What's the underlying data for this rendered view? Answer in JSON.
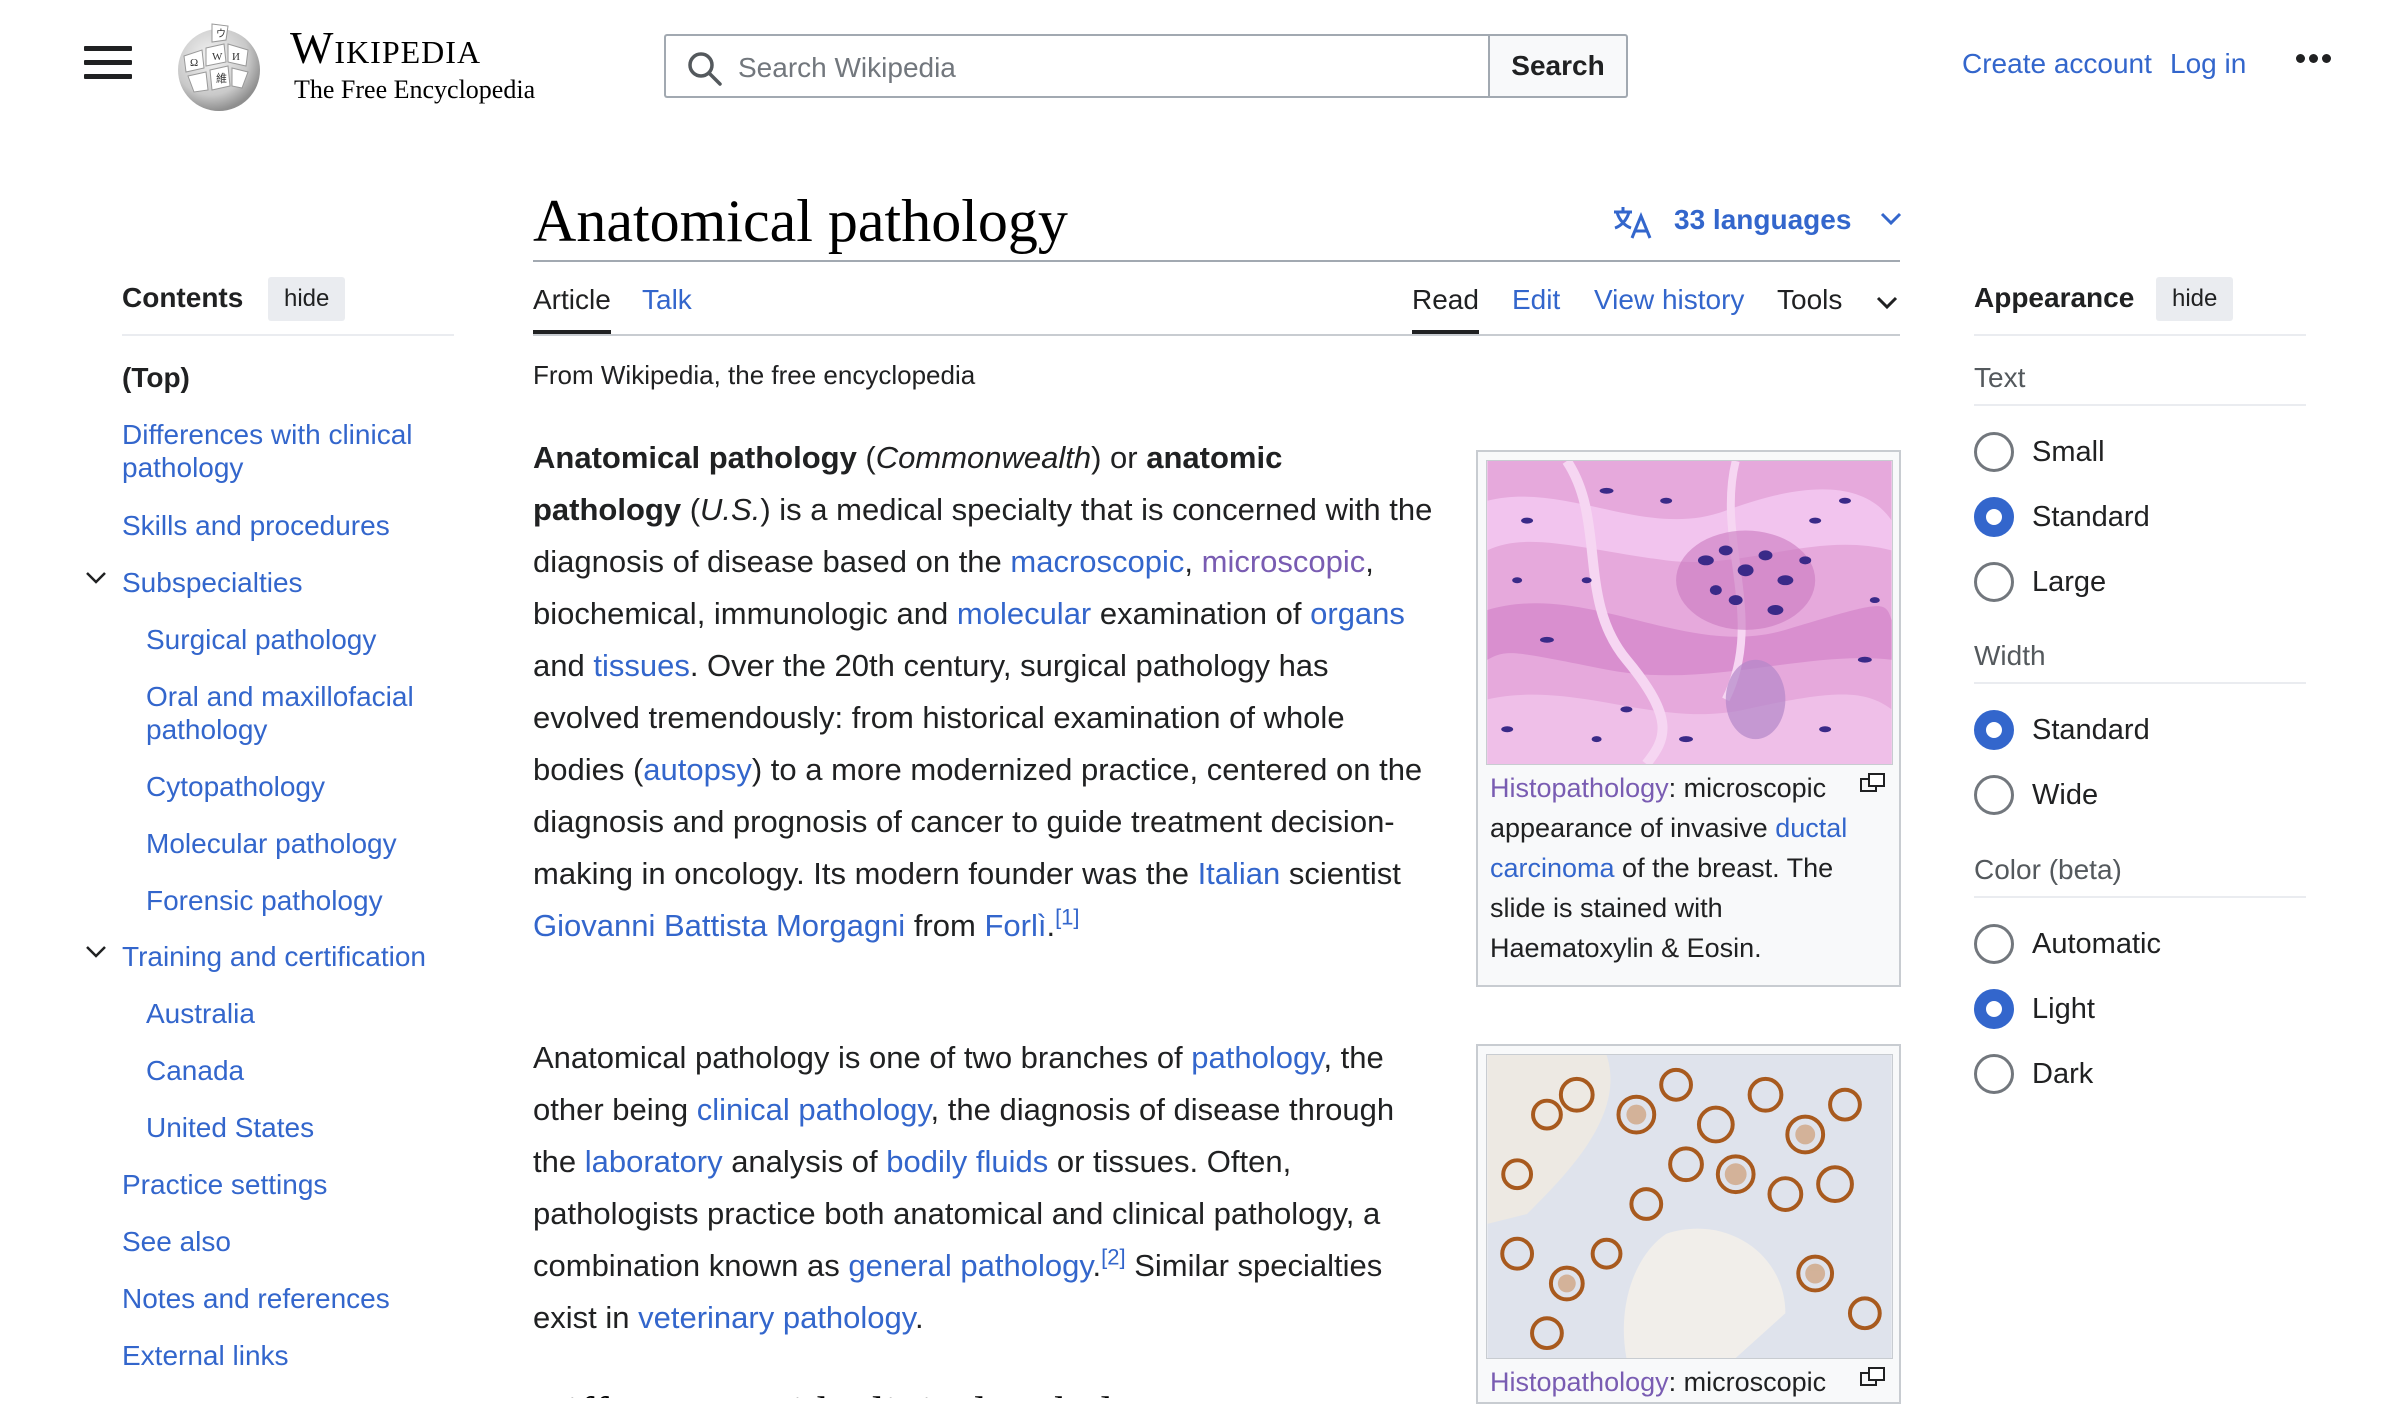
{
  "header": {
    "wordmark_title": "Wikipedia",
    "wordmark_tagline": "The Free Encyclopedia",
    "search_placeholder": "Search Wikipedia",
    "search_button": "Search",
    "create_account": "Create account",
    "log_in": "Log in"
  },
  "page": {
    "title": "Anatomical pathology",
    "languages": "33 languages",
    "tabs": {
      "article": "Article",
      "talk": "Talk",
      "read": "Read",
      "edit": "Edit",
      "view_history": "View history",
      "tools": "Tools"
    },
    "tagline": "From Wikipedia, the free encyclopedia"
  },
  "toc": {
    "heading": "Contents",
    "hide": "hide",
    "items": [
      "(Top)",
      "Differences with clinical pathology",
      "Skills and procedures",
      "Subspecialties",
      "Surgical pathology",
      "Oral and maxillofacial pathology",
      "Cytopathology",
      "Molecular pathology",
      "Forensic pathology",
      "Training and certification",
      "Australia",
      "Canada",
      "United States",
      "Practice settings",
      "See also",
      "Notes and references",
      "External links"
    ]
  },
  "article": {
    "p1": {
      "t1": "Anatomical pathology",
      "t2": " (",
      "t3": "Commonwealth",
      "t4": ") or ",
      "t5": "anatomic pathology",
      "t6": " (",
      "t7": "U.S.",
      "t8": ") is a medical specialty that is concerned with the diagnosis of disease based on the ",
      "l_macroscopic": "macroscopic",
      "t9": ", ",
      "l_microscopic": "microscopic",
      "t10": ", biochemical, immunologic and ",
      "l_molecular": "molecular",
      "t11": " examination of ",
      "l_organs": "organs",
      "t12": " and ",
      "l_tissues": "tissues",
      "t13": ". Over the 20th century, surgical pathology has evolved tremendously: from historical examination of whole bodies (",
      "l_autopsy": "autopsy",
      "t14": ") to a more modernized practice, centered on the diagnosis and prognosis of cancer to guide treatment decision-making in oncology. Its modern founder was the ",
      "l_italian": "Italian",
      "t15": " scientist ",
      "l_morgagni": "Giovanni Battista Morgagni",
      "t16": " from ",
      "l_forli": "Forlì",
      "t17": ".",
      "ref1": "[1]"
    },
    "p2": {
      "t1": "Anatomical pathology is one of two branches of ",
      "l_pathology": "pathology",
      "t2": ", the other being ",
      "l_clinical": "clinical pathology",
      "t3": ", the diagnosis of disease through the ",
      "l_laboratory": "laboratory",
      "t4": " analysis of ",
      "l_bodily": "bodily fluids",
      "t5": " or tissues. Often, pathologists practice both anatomical and clinical pathology, a combination known as ",
      "l_general": "general pathology",
      "t6": ".",
      "ref2": "[2]",
      "t7": " Similar specialties exist in ",
      "l_veterinary": "veterinary pathology",
      "t8": "."
    },
    "fig1": {
      "l_histo": "Histopathology",
      "t1": ": microscopic appearance of invasive ",
      "l_ductal": "ductal carcinoma",
      "t2": " of the breast. The slide is stained with Haematoxylin & Eosin."
    },
    "fig2": {
      "l_histo": "Histopathology",
      "t1": ": microscopic"
    },
    "next_heading": "Differences with clinical pathology"
  },
  "appearance": {
    "heading": "Appearance",
    "hide": "hide",
    "text_label": "Text",
    "text_options": [
      "Small",
      "Standard",
      "Large"
    ],
    "text_selected": "Standard",
    "width_label": "Width",
    "width_options": [
      "Standard",
      "Wide"
    ],
    "width_selected": "Standard",
    "color_label": "Color (beta)",
    "color_options": [
      "Automatic",
      "Light",
      "Dark"
    ],
    "color_selected": "Light"
  },
  "colors": {
    "link": "#3366cc",
    "visited": "#795cb2",
    "text": "#202122",
    "border": "#a2a9b1"
  }
}
